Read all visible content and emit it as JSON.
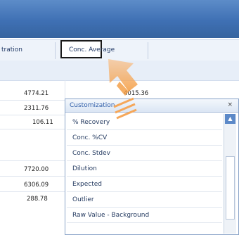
{
  "table": {
    "columns": [
      "tration",
      "Conc. Average"
    ],
    "rows_a": [
      "4774.21",
      "2311.76",
      "106.11"
    ],
    "rows_b": [
      "7720.00",
      "6306.09",
      "288.78"
    ],
    "extra_value": "4015.36"
  },
  "menu": {
    "title": "Customization",
    "close": "×",
    "items": [
      "% Recovery",
      "Conc. %CV",
      "Conc. Stdev",
      "Dilution",
      "Expected",
      "Outlier",
      "Raw Value - Background"
    ]
  },
  "icons": {
    "close": "close-icon",
    "scroll_up": "scroll-up-icon",
    "drag_arrow": "drag-arrow-icon"
  },
  "colors": {
    "title_bar": "#3f70b4",
    "accent": "#5c89c8",
    "arrow": "#f6a24a"
  }
}
